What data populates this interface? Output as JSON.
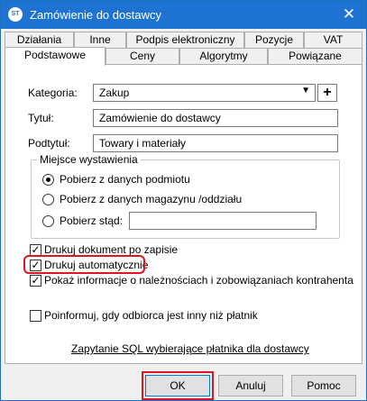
{
  "window": {
    "title": "Zamówienie do dostawcy",
    "app_icon_text": "ST",
    "close_glyph": "✕"
  },
  "tabs_row1": [
    {
      "label": "Działania"
    },
    {
      "label": "Inne"
    },
    {
      "label": "Podpis elektroniczny"
    },
    {
      "label": "Pozycje"
    },
    {
      "label": "VAT"
    }
  ],
  "tabs_row2": [
    {
      "label": "Podstawowe",
      "active": true
    },
    {
      "label": "Ceny"
    },
    {
      "label": "Algorytmy"
    },
    {
      "label": "Powiązane"
    }
  ],
  "form": {
    "kategoria_label": "Kategoria:",
    "kategoria_value": "Zakup",
    "add_glyph": "+",
    "tytul_label": "Tytuł:",
    "tytul_value": "Zamówienie do dostawcy",
    "podtytul_label": "Podtytuł:",
    "podtytul_value": "Towary i materiały"
  },
  "group": {
    "title": "Miejsce wystawienia",
    "options": [
      {
        "label": "Pobierz z danych podmiotu",
        "selected": true
      },
      {
        "label": "Pobierz z danych magazynu /oddziału",
        "selected": false
      },
      {
        "label": "Pobierz stąd:",
        "selected": false
      }
    ],
    "pobierz_stad_value": ""
  },
  "checkboxes": [
    {
      "label": "Drukuj dokument po zapisie",
      "checked": true
    },
    {
      "label": "Drukuj automatycznie",
      "checked": true,
      "highlighted": true
    },
    {
      "label": "Pokaż informacje o należnościach i zobowiązaniach kontrahenta",
      "checked": true
    },
    {
      "label": "Poinformuj, gdy odbiorca jest inny niż płatnik",
      "checked": false
    }
  ],
  "check_glyph": "✓",
  "sql_link": "Zapytanie SQL wybierające płatnika dla dostawcy",
  "buttons": {
    "ok": "OK",
    "cancel": "Anuluj",
    "help": "Pomoc"
  },
  "colors": {
    "titlebar": "#1e73d2",
    "highlight": "#e0141e"
  }
}
